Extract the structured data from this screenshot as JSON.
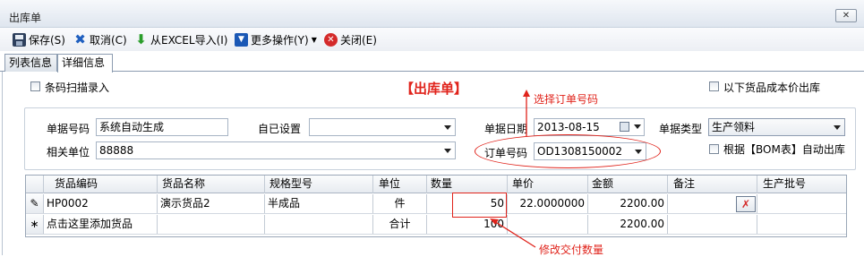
{
  "window": {
    "title": "出库单",
    "close_label": "✕"
  },
  "toolbar": {
    "save": "保存(S)",
    "cancel": "取消(C)",
    "import": "从EXCEL导入(I)",
    "more": "更多操作(Y)",
    "close": "关闭(E)"
  },
  "tabs": [
    {
      "label": "列表信息",
      "active": false
    },
    {
      "label": "详细信息",
      "active": true
    }
  ],
  "form": {
    "barcode_label": "条码扫描录入",
    "heading": "【出库单】",
    "cost_out_label": "以下货品成本价出库",
    "doc_no_label": "单据号码",
    "doc_no_value": "系统自动生成",
    "custom_label": "自已设置",
    "custom_value": "",
    "date_label": "单据日期",
    "date_value": "2013-08-15",
    "type_label": "单据类型",
    "type_value": "生产领料",
    "related_label": "相关单位",
    "related_value": "88888",
    "order_label": "订单号码",
    "order_value": "OD1308150002",
    "bom_label": "根据【BOM表】自动出库"
  },
  "grid": {
    "headers": [
      "货品编码",
      "货品名称",
      "规格型号",
      "单位",
      "数量",
      "单价",
      "金额",
      "备注",
      "生产批号"
    ],
    "rows": [
      {
        "marker": "✎",
        "code": "HP0002",
        "name": "演示货品2",
        "spec": "半成品",
        "unit": "件",
        "qty": "50",
        "price": "22.0000000",
        "amount": "2200.00",
        "remark": "",
        "batch": ""
      },
      {
        "marker": "∗",
        "code": "点击这里添加货品",
        "name": "",
        "spec": "",
        "unit": "合计",
        "qty": "100",
        "price": "",
        "amount": "2200.00",
        "remark": "",
        "batch": ""
      }
    ],
    "delete_icon": "✗"
  },
  "annotations": {
    "select_order": "选择订单号码",
    "edit_qty": "修改交付数量"
  },
  "colors": {
    "annotation": "#e0231b",
    "heading": "#e0231b"
  }
}
